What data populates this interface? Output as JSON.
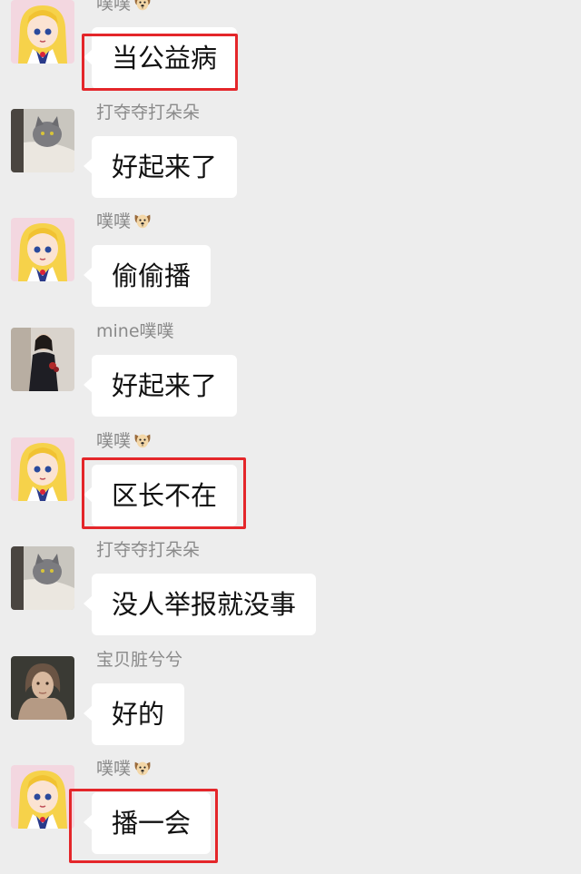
{
  "colors": {
    "background": "#ededed",
    "bubble": "#ffffff",
    "nickname": "#8a8a8a",
    "highlight": "#e4262a"
  },
  "messages": [
    {
      "sender": "噗噗",
      "emoji_icon": "dog-face-icon",
      "avatar_icon": "anime-girl-avatar-icon",
      "text": "当公益病",
      "highlighted": true
    },
    {
      "sender": "打夺夺打朵朵",
      "avatar_icon": "cat-photo-avatar-icon",
      "text": "好起来了",
      "highlighted": false
    },
    {
      "sender": "噗噗",
      "emoji_icon": "dog-face-icon",
      "avatar_icon": "anime-girl-avatar-icon",
      "text": "偷偷播",
      "highlighted": false
    },
    {
      "sender": "mine噗噗",
      "avatar_icon": "person-photo-avatar-icon",
      "text": "好起来了",
      "highlighted": false
    },
    {
      "sender": "噗噗",
      "emoji_icon": "dog-face-icon",
      "avatar_icon": "anime-girl-avatar-icon",
      "text": "区长不在",
      "highlighted": true
    },
    {
      "sender": "打夺夺打朵朵",
      "avatar_icon": "cat-photo-avatar-icon",
      "text": "没人举报就没事",
      "highlighted": false
    },
    {
      "sender": "宝贝脏兮兮",
      "avatar_icon": "portrait-photo-avatar-icon",
      "text": "好的",
      "highlighted": false
    },
    {
      "sender": "噗噗",
      "emoji_icon": "dog-face-icon",
      "avatar_icon": "anime-girl-avatar-icon",
      "text": "播一会",
      "highlighted": true
    }
  ]
}
